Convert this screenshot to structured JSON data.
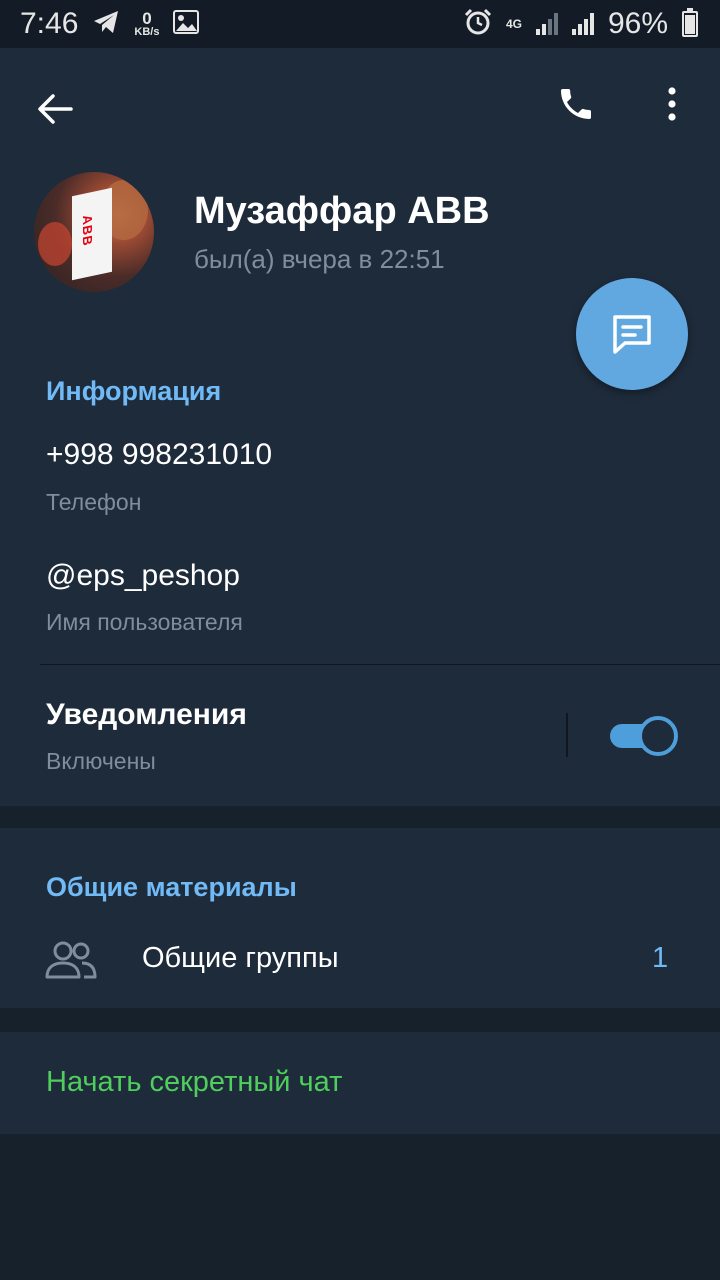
{
  "status_bar": {
    "time": "7:46",
    "net_speed": "0",
    "net_unit": "KB/s",
    "network_type": "4G",
    "battery_percent": "96%"
  },
  "header": {
    "back_icon": "arrow-left-icon",
    "call_icon": "phone-icon",
    "menu_icon": "more-vertical-icon",
    "avatar_text": "ABB",
    "name": "Музаффар ABB",
    "last_seen": "был(а) вчера в 22:51",
    "fab_icon": "message-icon"
  },
  "info": {
    "title": "Информация",
    "phone_value": "+998 998231010",
    "phone_label": "Телефон",
    "username_value": "@eps_peshop",
    "username_label": "Имя пользователя",
    "notifications_title": "Уведомления",
    "notifications_state": "Включены",
    "notifications_enabled": true
  },
  "shared": {
    "title": "Общие материалы",
    "groups_icon": "users-icon",
    "groups_label": "Общие группы",
    "groups_count": "1"
  },
  "secret": {
    "label": "Начать секретный чат"
  },
  "colors": {
    "background": "#17212b",
    "panel": "#1e2b3a",
    "accent_blue": "#71baf5",
    "fab": "#62a8e0",
    "secret_green": "#4fce5d",
    "secondary_text": "#7f8d9c"
  }
}
